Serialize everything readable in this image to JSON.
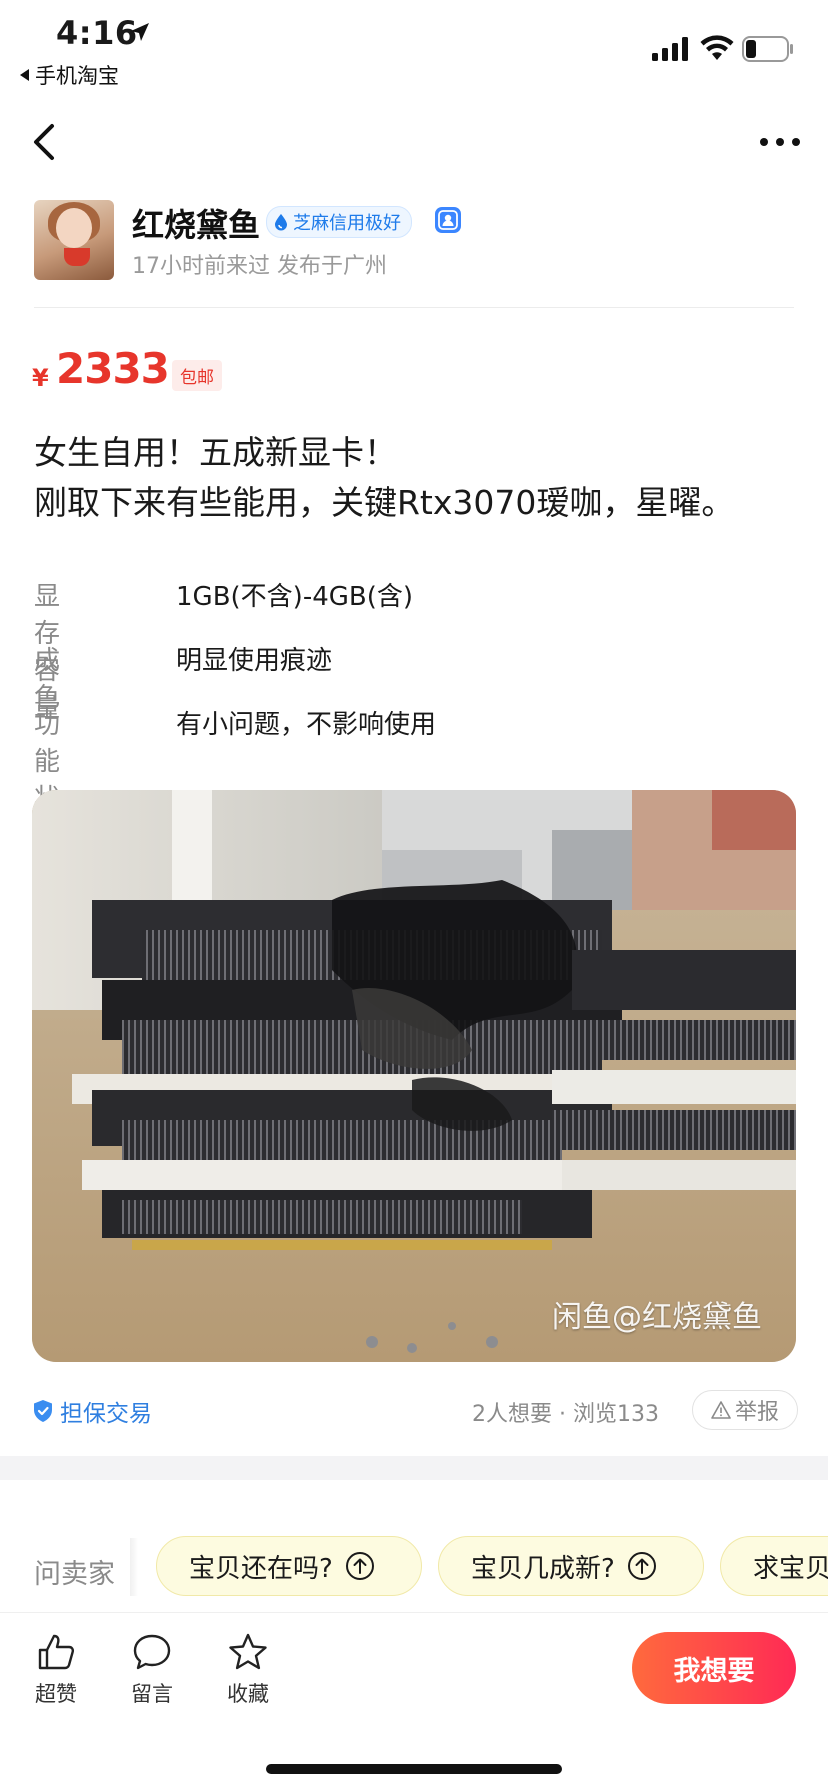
{
  "status_bar": {
    "time": "4:16",
    "back_app": "手机淘宝"
  },
  "seller": {
    "name": "红烧黛鱼",
    "credit_badge": "芝麻信用极好",
    "meta": "17小时前来过 发布于广州"
  },
  "price": {
    "currency": "¥",
    "value": "2333",
    "free_shipping": "包邮"
  },
  "title": {
    "line1": "女生自用！五成新显卡！",
    "line2": "刚取下来有些能用，关键Rtx3070瑷咖，星曜。"
  },
  "attributes": [
    {
      "label": "显存容量",
      "value": "1GB(不含)-4GB(含)"
    },
    {
      "label": "成色",
      "value": "明显使用痕迹"
    },
    {
      "label": "功能状态",
      "value": "有小问题，不影响使用"
    }
  ],
  "photo": {
    "watermark": "闲鱼@红烧黛鱼"
  },
  "guarantee": {
    "label": "担保交易",
    "stats": "2人想要 · 浏览133",
    "report": "举报"
  },
  "ask": {
    "label": "问卖家",
    "chips": [
      "宝贝还在吗?",
      "宝贝几成新?",
      "求宝贝"
    ]
  },
  "actions": {
    "like": "超赞",
    "comment": "留言",
    "favorite": "收藏",
    "want": "我想要"
  },
  "colors": {
    "price_red": "#e7352b",
    "link_blue": "#2f7fe0",
    "want_gradient_start": "#ff6a3d",
    "want_gradient_end": "#ff2a55",
    "chip_bg": "#fdfbe0"
  }
}
